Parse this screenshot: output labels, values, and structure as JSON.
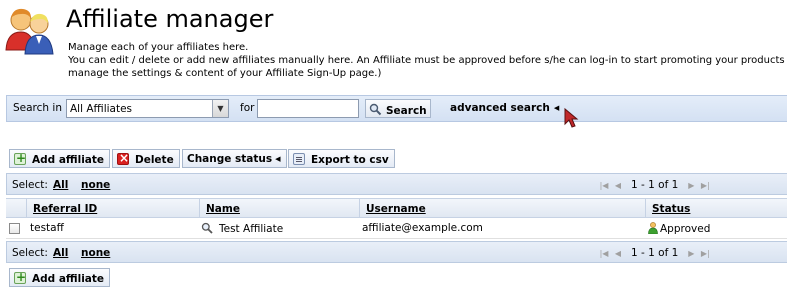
{
  "header": {
    "icon": "affiliates-people-icon",
    "title": "Affiliate manager",
    "description_lines": [
      "Manage each of your affiliates here.",
      "You can edit / delete or add new affiliates manually here. An Affiliate must be approved before s/he can log-in to start promoting your products or serv",
      "manage the settings & content of your Affiliate Sign-Up page.)"
    ]
  },
  "search": {
    "search_in_label": "Search in",
    "scope_selected": "All Affiliates",
    "for_label": "for",
    "query_value": "",
    "search_button": "Search",
    "advanced_label": "advanced search"
  },
  "toolbar": {
    "add_affiliate": "Add affiliate",
    "delete": "Delete",
    "change_status": "Change status",
    "export_csv": "Export to csv"
  },
  "selection": {
    "select_label": "Select:",
    "all": "All",
    "none": "none"
  },
  "pager": {
    "range_text": "1 - 1 of 1"
  },
  "table": {
    "columns": [
      "Referral ID",
      "Name",
      "Username",
      "Status"
    ],
    "rows": [
      {
        "referral_id": "testaff",
        "name": "Test Affiliate",
        "username": "affiliate@example.com",
        "status": "Approved"
      }
    ]
  },
  "bottom_toolbar": {
    "add_affiliate": "Add affiliate"
  },
  "colors": {
    "bar_background": "#d4e1f3",
    "bar_border": "#b7c8e2",
    "delete_icon": "#d92020",
    "add_icon": "#2f8a1e"
  }
}
